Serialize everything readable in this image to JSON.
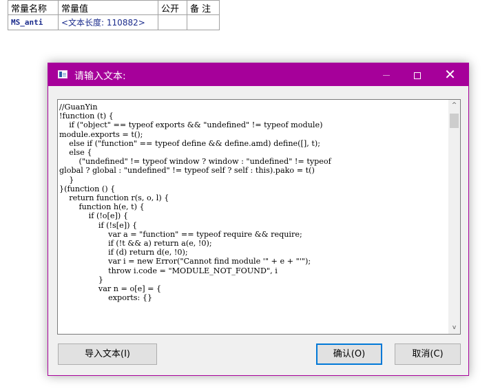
{
  "table": {
    "headers": [
      "常量名称",
      "常量值",
      "公开",
      "备 注"
    ],
    "rows": [
      {
        "name": "MS_anti",
        "value": "<文本长度: 110882>",
        "public": "",
        "note": ""
      }
    ]
  },
  "dialog": {
    "title": "请输入文本:",
    "icons": {
      "app": "window-app-icon",
      "minimize": "minimize-icon",
      "maximize": "maximize-icon",
      "close": "close-icon"
    },
    "close_glyph": "✕",
    "scroll_up_glyph": "^",
    "scroll_down_glyph": "v",
    "code": "//GuanYin\n!function (t) {\n    if (\"object\" == typeof exports && \"undefined\" != typeof module)\nmodule.exports = t();\n    else if (\"function\" == typeof define && define.amd) define([], t);\n    else {\n        (\"undefined\" != typeof window ? window : \"undefined\" != typeof\nglobal ? global : \"undefined\" != typeof self ? self : this).pako = t()\n    }\n}(function () {\n    return function r(s, o, l) {\n        function h(e, t) {\n            if (!o[e]) {\n                if (!s[e]) {\n                    var a = \"function\" == typeof require && require;\n                    if (!t && a) return a(e, !0);\n                    if (d) return d(e, !0);\n                    var i = new Error(\"Cannot find module '\" + e + \"'\");\n                    throw i.code = \"MODULE_NOT_FOUND\", i\n                }\n                var n = o[e] = {\n                    exports: {}",
    "buttons": {
      "import": "导入文本(I)",
      "ok": "确认(O)",
      "cancel": "取消(C)"
    }
  }
}
